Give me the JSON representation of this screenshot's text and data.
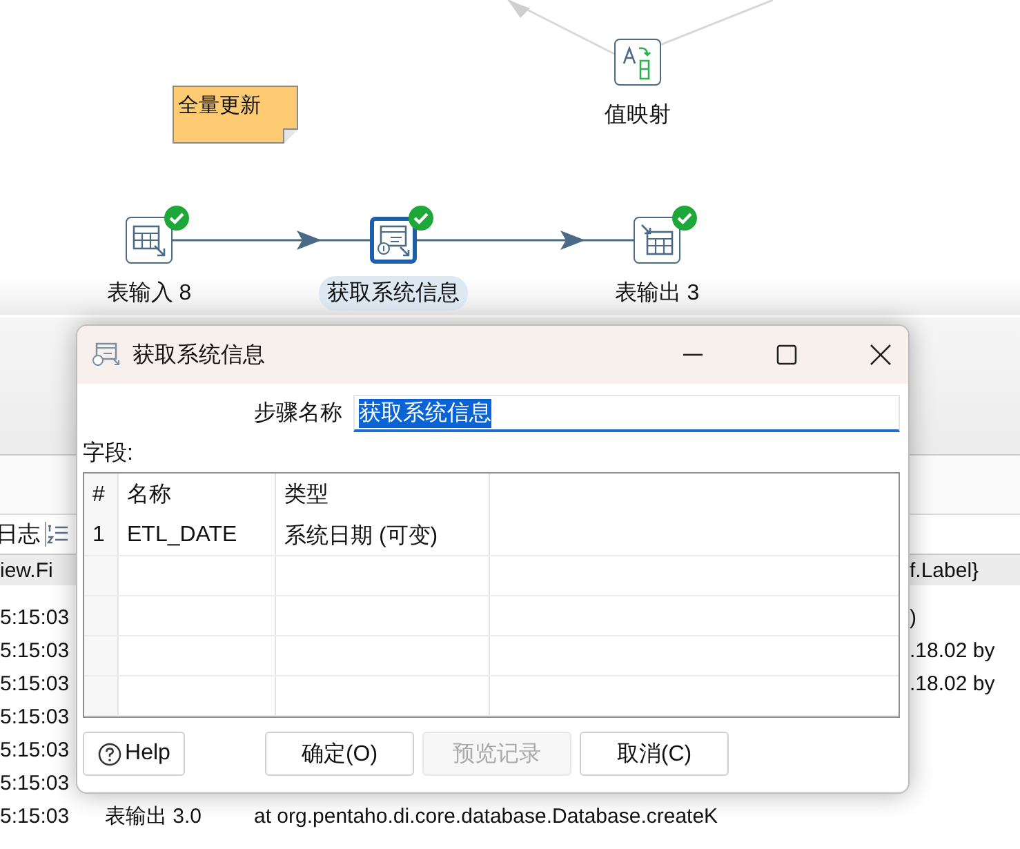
{
  "canvas": {
    "note": "全量更新",
    "nodes": [
      {
        "kind": "value-mapper",
        "label": "值映射",
        "selected": false,
        "valid": false
      },
      {
        "kind": "table-input",
        "label": "表输入 8",
        "selected": false,
        "valid": true
      },
      {
        "kind": "system-info",
        "label": "获取系统信息",
        "selected": true,
        "valid": true
      },
      {
        "kind": "table-output",
        "label": "表输出 3",
        "selected": false,
        "valid": true
      }
    ]
  },
  "log": {
    "tab": "日志",
    "header": {
      "left": "iew.Fi",
      "right": "f.Label}"
    },
    "rows": [
      {
        "time": "5:15:03",
        "tail": ")"
      },
      {
        "time": "5:15:03",
        "tail": ".18.02 by"
      },
      {
        "time": "5:15:03",
        "tail": ".18.02 by"
      },
      {
        "time": "5:15:03"
      },
      {
        "time": "5:15:03"
      },
      {
        "time": "5:15:03"
      },
      {
        "time": "5:15:03",
        "step": "表输出 3.0",
        "message": "at org.pentaho.di.core.database.Database.createK"
      }
    ]
  },
  "dialog": {
    "title": "获取系统信息",
    "step_name_label": "步骤名称",
    "step_name": "获取系统信息",
    "fields_label": "字段:",
    "columns": [
      "#",
      "名称",
      "类型"
    ],
    "rows": [
      {
        "index": "1",
        "name": "ETL_DATE",
        "type": "系统日期 (可变)"
      }
    ],
    "buttons": [
      {
        "kind": "help",
        "label": "Help",
        "disabled": false
      },
      {
        "kind": "ok",
        "label": "确定(O)",
        "disabled": false
      },
      {
        "kind": "preview",
        "label": "预览记录",
        "disabled": true
      },
      {
        "kind": "cancel",
        "label": "取消(C)",
        "disabled": false
      }
    ]
  }
}
